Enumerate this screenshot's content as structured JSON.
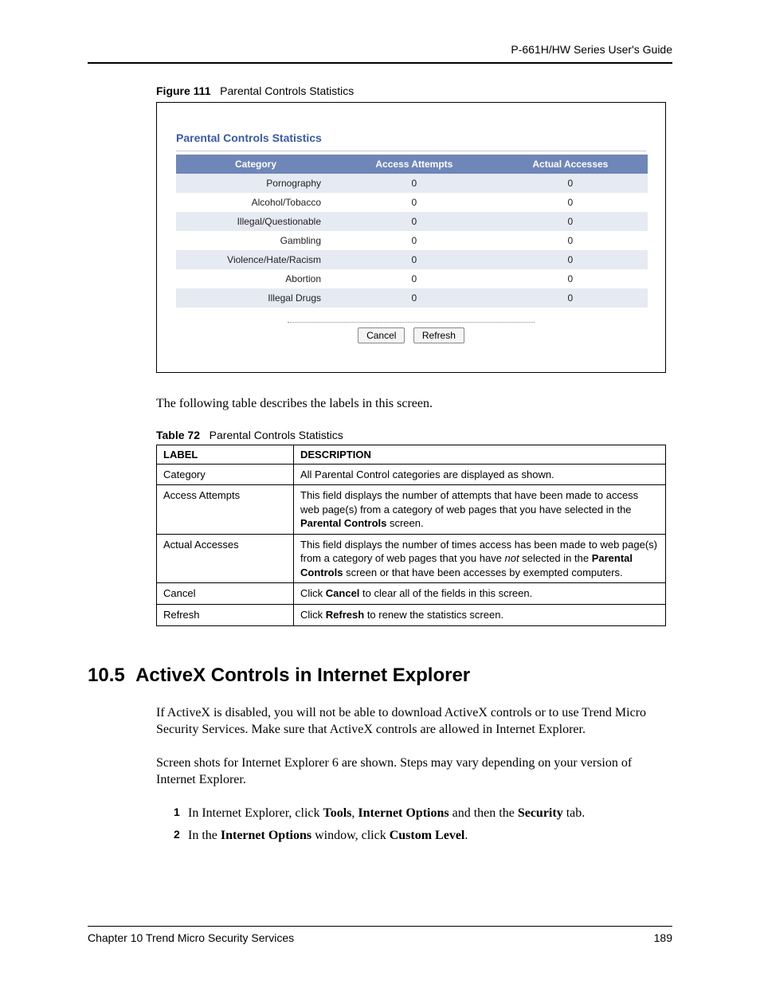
{
  "header": {
    "guide": "P-661H/HW Series User's Guide"
  },
  "figure": {
    "label": "Figure 111",
    "title": "Parental Controls Statistics",
    "panel_title": "Parental Controls Statistics",
    "headers": [
      "Category",
      "Access Attempts",
      "Actual Accesses"
    ],
    "rows": [
      {
        "category": "Pornography",
        "attempts": "0",
        "accesses": "0"
      },
      {
        "category": "Alcohol/Tobacco",
        "attempts": "0",
        "accesses": "0"
      },
      {
        "category": "Illegal/Questionable",
        "attempts": "0",
        "accesses": "0"
      },
      {
        "category": "Gambling",
        "attempts": "0",
        "accesses": "0"
      },
      {
        "category": "Violence/Hate/Racism",
        "attempts": "0",
        "accesses": "0"
      },
      {
        "category": "Abortion",
        "attempts": "0",
        "accesses": "0"
      },
      {
        "category": "Illegal Drugs",
        "attempts": "0",
        "accesses": "0"
      }
    ],
    "buttons": {
      "cancel": "Cancel",
      "refresh": "Refresh"
    }
  },
  "intro_text": "The following table describes the labels in this screen.",
  "table72": {
    "label": "Table 72",
    "title": "Parental Controls Statistics",
    "headers": {
      "label": "LABEL",
      "description": "DESCRIPTION"
    },
    "rows": [
      {
        "label": "Category",
        "desc_plain": "All Parental Control categories are displayed as shown."
      },
      {
        "label": "Access Attempts",
        "desc_pre": "This field displays the number of attempts that have been made to access web page(s) from a category of web pages that you have selected in the ",
        "desc_bold": "Parental Controls",
        "desc_post": " screen."
      },
      {
        "label": "Actual Accesses",
        "desc_pre": "This field displays the number of times access has been made to web page(s) from a category of web pages that you have ",
        "desc_italic": "not",
        "desc_mid": " selected in the ",
        "desc_bold": "Parental Controls",
        "desc_post": " screen or that have been accesses by exempted computers."
      },
      {
        "label": "Cancel",
        "desc_pre": "Click ",
        "desc_bold": "Cancel",
        "desc_post": " to clear all of the fields in this screen."
      },
      {
        "label": "Refresh",
        "desc_pre": "Click ",
        "desc_bold": "Refresh",
        "desc_post": " to renew the statistics screen."
      }
    ]
  },
  "section": {
    "number": "10.5",
    "title": "ActiveX Controls in Internet Explorer",
    "para1": "If ActiveX is disabled, you will not be able to download ActiveX controls or to use Trend Micro Security Services. Make sure that ActiveX controls are allowed in Internet Explorer.",
    "para2": "Screen shots for Internet Explorer 6 are shown. Steps may vary depending on your version of Internet Explorer.",
    "steps": [
      {
        "num": "1",
        "pre": "In Internet Explorer, click ",
        "b1": "Tools",
        "s1": ", ",
        "b2": "Internet Options",
        "s2": " and then the ",
        "b3": "Security",
        "s3": " tab."
      },
      {
        "num": "2",
        "pre": "In the ",
        "b1": "Internet Options",
        "s1": " window, click ",
        "b2": "Custom Level",
        "s2": ".",
        "b3": "",
        "s3": ""
      }
    ]
  },
  "footer": {
    "chapter": "Chapter 10 Trend Micro Security Services",
    "page": "189"
  }
}
